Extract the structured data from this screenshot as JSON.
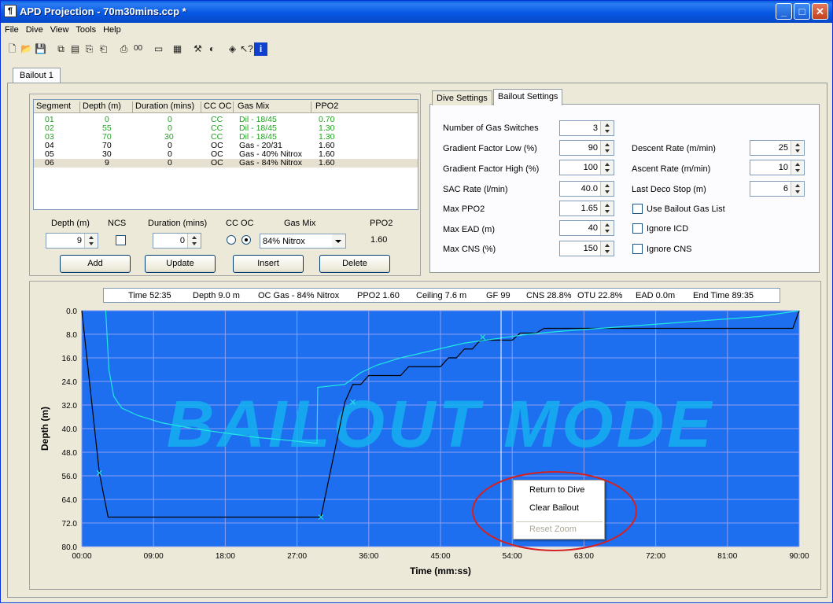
{
  "window": {
    "title": "APD Projection - 70m30mins.ccp *"
  },
  "menu": [
    "File",
    "Dive",
    "View",
    "Tools",
    "Help"
  ],
  "doc_tab": "Bailout 1",
  "segments": {
    "headers": [
      "Segment",
      "Depth (m)",
      "Duration (mins)",
      "CC OC",
      "Gas Mix",
      "PPO2"
    ],
    "rows": [
      {
        "seg": "01",
        "depth": "0",
        "duration": "0",
        "ccoc": "CC",
        "gas": "Dil - 18/45",
        "ppo2": "0.70"
      },
      {
        "seg": "02",
        "depth": "55",
        "duration": "0",
        "ccoc": "CC",
        "gas": "Dil - 18/45",
        "ppo2": "1.30"
      },
      {
        "seg": "03",
        "depth": "70",
        "duration": "30",
        "ccoc": "CC",
        "gas": "Dil - 18/45",
        "ppo2": "1.30"
      },
      {
        "seg": "04",
        "depth": "70",
        "duration": "0",
        "ccoc": "OC",
        "gas": "Gas - 20/31",
        "ppo2": "1.60"
      },
      {
        "seg": "05",
        "depth": "30",
        "duration": "0",
        "ccoc": "OC",
        "gas": "Gas - 40% Nitrox",
        "ppo2": "1.60"
      },
      {
        "seg": "06",
        "depth": "9",
        "duration": "0",
        "ccoc": "OC",
        "gas": "Gas - 84% Nitrox",
        "ppo2": "1.60"
      }
    ]
  },
  "editor": {
    "depth_label": "Depth (m)",
    "ncs_label": "NCS",
    "duration_label": "Duration (mins)",
    "ccoc_label": "CC OC",
    "gasmix_label": "Gas Mix",
    "ppo2_label": "PPO2",
    "depth_value": "9",
    "duration_value": "0",
    "gasmix_value": "84% Nitrox",
    "ppo2_value": "1.60",
    "add": "Add",
    "update": "Update",
    "insert": "Insert",
    "delete": "Delete"
  },
  "settings": {
    "tabs": [
      "Dive Settings",
      "Bailout Settings"
    ],
    "num_gas_switches": {
      "label": "Number of Gas Switches",
      "value": "3"
    },
    "gf_low": {
      "label": "Gradient Factor Low (%)",
      "value": "90"
    },
    "gf_high": {
      "label": "Gradient Factor High (%)",
      "value": "100"
    },
    "sac": {
      "label": "SAC Rate (l/min)",
      "value": "40.0"
    },
    "max_ppo2": {
      "label": "Max PPO2",
      "value": "1.65"
    },
    "max_ead": {
      "label": "Max EAD (m)",
      "value": "40"
    },
    "max_cns": {
      "label": "Max CNS (%)",
      "value": "150"
    },
    "descent": {
      "label": "Descent Rate (m/min)",
      "value": "25"
    },
    "ascent": {
      "label": "Ascent Rate (m/min)",
      "value": "10"
    },
    "last_deco": {
      "label": "Last Deco Stop (m)",
      "value": "6"
    },
    "use_bailout_gas": "Use Bailout Gas List",
    "ignore_icd": "Ignore ICD",
    "ignore_cns": "Ignore CNS"
  },
  "status": {
    "time": "Time 52:35",
    "depth": "Depth 9.0 m",
    "gas": "OC  Gas - 84% Nitrox",
    "ppo2": "PPO2 1.60",
    "ceiling": "Ceiling 7.6 m",
    "gf": "GF 99",
    "cns": "CNS 28.8%",
    "otu": "OTU 22.8%",
    "ead": "EAD 0.0m",
    "end_time": "End Time 89:35"
  },
  "context_menu": {
    "return": "Return to Dive",
    "clear": "Clear Bailout",
    "reset": "Reset Zoom"
  },
  "chart_data": {
    "type": "line",
    "watermark": "BAILOUT MODE",
    "xlabel": "Time (mm:ss)",
    "ylabel": "Depth (m)",
    "xlim": [
      0,
      90
    ],
    "ylim": [
      0,
      80
    ],
    "x_ticks": [
      "00:00",
      "09:00",
      "18:00",
      "27:00",
      "36:00",
      "45:00",
      "54:00",
      "63:00",
      "72:00",
      "81:00",
      "90:00"
    ],
    "y_ticks": [
      "0.0",
      "8.0",
      "16.0",
      "24.0",
      "32.0",
      "40.0",
      "48.0",
      "56.0",
      "64.0",
      "72.0",
      "80.0"
    ],
    "cursor_time": 52.6,
    "background": "#1e6ff0",
    "series": [
      {
        "color": "#000000",
        "x": [
          0,
          2.2,
          3.3,
          30,
          33,
          34,
          35,
          36,
          37,
          40,
          41,
          44,
          45,
          46,
          47,
          48,
          49,
          50,
          50.5,
          54,
          55,
          57,
          58,
          80,
          81,
          89.2,
          90
        ],
        "y": [
          0,
          55,
          70,
          70,
          31,
          25,
          25,
          22,
          22,
          22,
          19,
          19,
          19,
          16,
          16,
          13,
          13,
          10,
          10,
          10,
          7.6,
          7.6,
          6,
          6,
          6,
          6,
          0
        ]
      },
      {
        "color": "#20e8e0",
        "x": [
          3.0,
          3.4,
          4.0,
          5,
          7,
          10,
          14,
          18,
          22,
          26,
          29.5,
          29.6,
          33,
          35,
          37,
          40,
          44,
          48,
          52,
          56,
          60,
          65,
          70,
          75,
          80,
          85,
          90
        ],
        "y": [
          0,
          20,
          29,
          33,
          35.5,
          38,
          40,
          41.5,
          43,
          44,
          45,
          26,
          25,
          21,
          18.5,
          16,
          13.5,
          11,
          9.5,
          8,
          7,
          6,
          5,
          4,
          3,
          2,
          0
        ]
      }
    ],
    "markers": [
      {
        "x": 2.2,
        "y": 55
      },
      {
        "x": 30,
        "y": 70
      },
      {
        "x": 34,
        "y": 31
      },
      {
        "x": 50.3,
        "y": 9
      }
    ]
  }
}
